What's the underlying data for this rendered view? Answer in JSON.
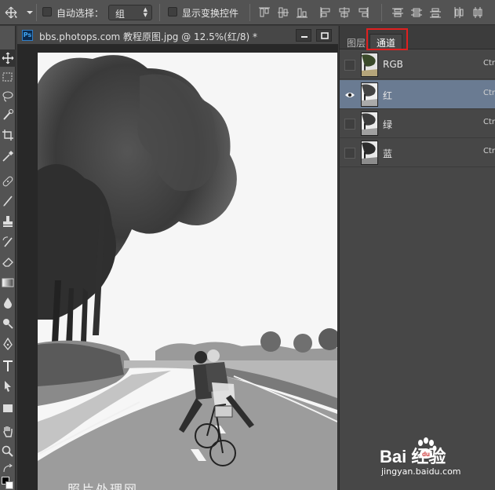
{
  "options_bar": {
    "auto_select_label": "自动选择：",
    "auto_select_value": "组",
    "show_transform_label": "显示变换控件"
  },
  "document": {
    "title": "bbs.photops.com 教程原图.jpg @ 12.5%(红/8) *",
    "ps_badge": "Ps",
    "image_watermark": "照片处理网"
  },
  "panel": {
    "tabs": [
      "图层",
      "通道"
    ],
    "active_tab": "通道",
    "channels": [
      {
        "name": "RGB",
        "shortcut": "Ctrl",
        "visible": false,
        "selected": false
      },
      {
        "name": "红",
        "shortcut": "Ctrl",
        "visible": true,
        "selected": true
      },
      {
        "name": "绿",
        "shortcut": "Ctrl",
        "visible": false,
        "selected": false
      },
      {
        "name": "蓝",
        "shortcut": "Ctrl",
        "visible": false,
        "selected": false
      }
    ]
  },
  "baidu": {
    "logo": "Bai  经验",
    "url": "jingyan.baidu.com"
  },
  "colors": {
    "highlight_box": "#e02020",
    "selected_row": "#6a7b92"
  }
}
